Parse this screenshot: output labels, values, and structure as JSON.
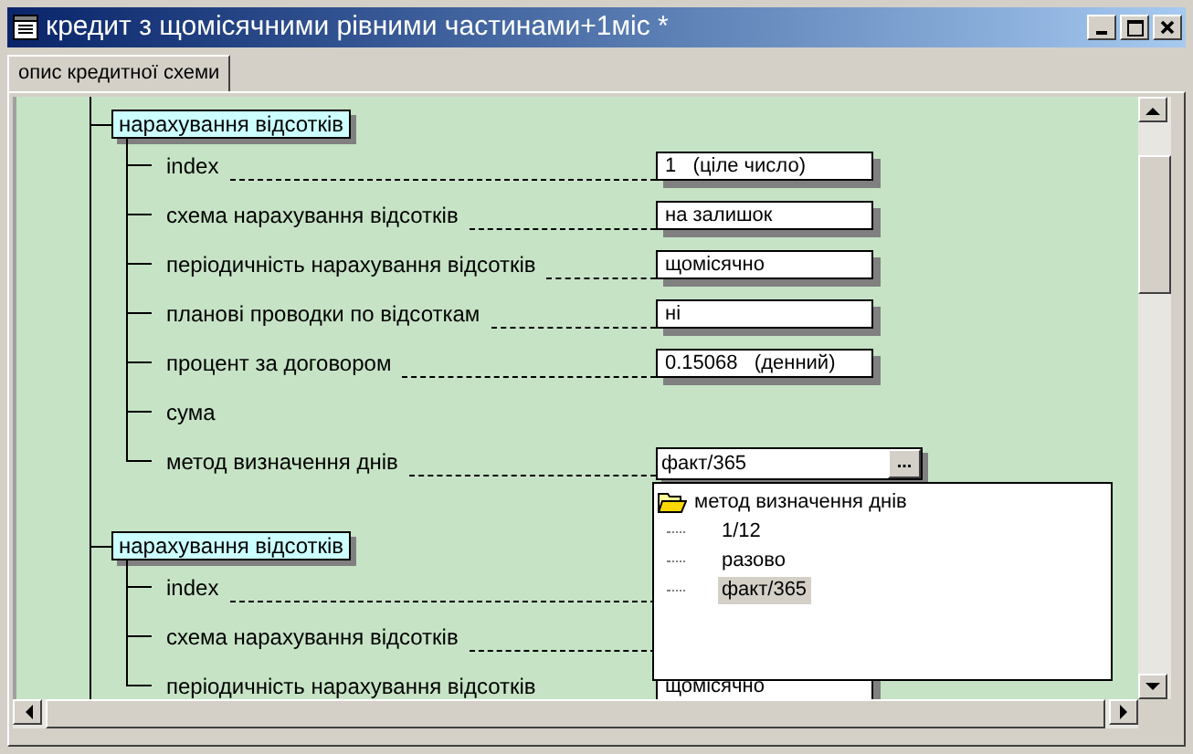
{
  "window": {
    "title": "кредит з щомісячними рівними частинами+1міс *"
  },
  "tabs": [
    {
      "label": "опис кредитної схеми",
      "selected": true
    }
  ],
  "groups": [
    {
      "title": "нарахування відсотків",
      "fields": [
        {
          "label": "index",
          "kind": "value",
          "value": "1   (ціле число)"
        },
        {
          "label": "схема нарахування відсотків",
          "kind": "value",
          "value": "на залишок"
        },
        {
          "label": "періодичність нарахування відсотків",
          "kind": "value",
          "value": "щомісячно"
        },
        {
          "label": "планові проводки по відсоткам",
          "kind": "value",
          "value": "ні"
        },
        {
          "label": "процент за договором",
          "kind": "value",
          "value": "0.15068   (денний)"
        },
        {
          "label": "сума",
          "kind": "none"
        },
        {
          "label": "метод визначення днів",
          "kind": "combo",
          "value": "факт/365",
          "button": "..."
        }
      ]
    },
    {
      "title": "нарахування відсотків",
      "fields": [
        {
          "label": "index",
          "kind": "hidden"
        },
        {
          "label": "схема нарахування відсотків",
          "kind": "hidden"
        },
        {
          "label": "періодичність нарахування відсотків",
          "kind": "value",
          "value": "щомісячно"
        }
      ]
    }
  ],
  "dropdown": {
    "title": "метод визначення днів",
    "options": [
      {
        "label": "1/12",
        "selected": false
      },
      {
        "label": "разово",
        "selected": false
      },
      {
        "label": "факт/365",
        "selected": true
      }
    ]
  }
}
